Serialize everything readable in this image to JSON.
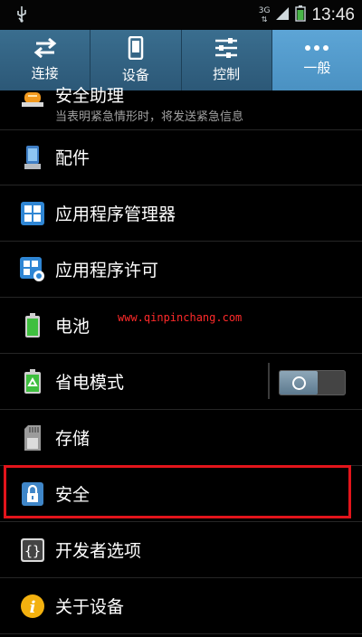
{
  "status_bar": {
    "network": "3G",
    "time": "13:46"
  },
  "tabs": [
    {
      "label": "连接",
      "icon": "swap-arrows-icon",
      "active": false
    },
    {
      "label": "设备",
      "icon": "phone-icon",
      "active": false
    },
    {
      "label": "控制",
      "icon": "sliders-icon",
      "active": false
    },
    {
      "label": "一般",
      "icon": "more-dots-icon",
      "active": true
    }
  ],
  "list": {
    "items": [
      {
        "label": "安全助理",
        "subtitle": "当表明紧急情形时，将发送紧急信息",
        "icon": "alarm-icon"
      },
      {
        "label": "配件",
        "icon": "accessory-icon"
      },
      {
        "label": "应用程序管理器",
        "icon": "app-grid-icon"
      },
      {
        "label": "应用程序许可",
        "icon": "app-permission-icon"
      },
      {
        "label": "电池",
        "icon": "battery-icon"
      },
      {
        "label": "省电模式",
        "icon": "power-saving-icon",
        "toggle": "off"
      },
      {
        "label": "存储",
        "icon": "sd-card-icon"
      },
      {
        "label": "安全",
        "icon": "lock-icon",
        "highlighted": true
      },
      {
        "label": "开发者选项",
        "icon": "braces-icon"
      },
      {
        "label": "关于设备",
        "icon": "info-icon"
      }
    ]
  },
  "watermark": "www.qinpinchang.com",
  "colors": {
    "tab_bar": "#2c5877",
    "tab_active": "#4a91c2",
    "highlight": "#e2141b"
  }
}
